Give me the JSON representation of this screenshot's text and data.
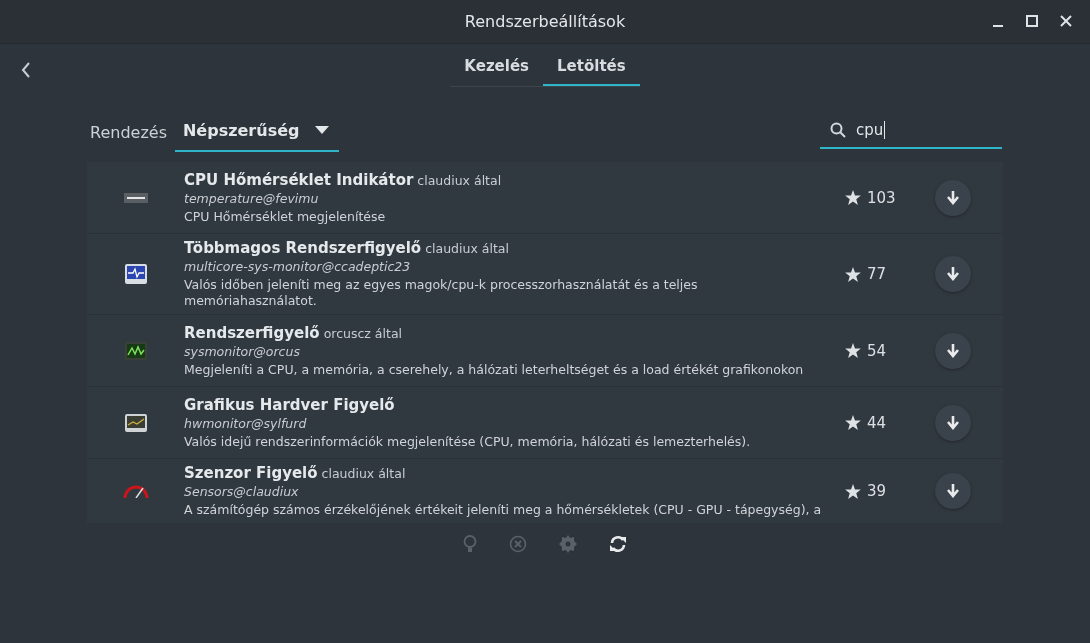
{
  "window": {
    "title": "Rendszerbeállítások"
  },
  "tabs": [
    {
      "label": "Kezelés",
      "selected": false
    },
    {
      "label": "Letöltés",
      "selected": true
    }
  ],
  "sort": {
    "label": "Rendezés",
    "value": "Népszerűség"
  },
  "search": {
    "value": "cpu"
  },
  "applets": [
    {
      "kind": "temp",
      "name": "CPU Hőmérséklet Indikátor",
      "author": "claudiux által",
      "uuid": "temperature@fevimu",
      "description": "CPU Hőmérséklet megjelenítése",
      "rating": "103"
    },
    {
      "kind": "pulse",
      "name": "Többmagos Rendszerfigyelő",
      "author": "claudiux által",
      "uuid": "multicore-sys-monitor@ccadeptic23",
      "description": "Valós időben jeleníti meg az egyes magok/cpu-k processzorhasználatát és a teljes memóriahasználatot.",
      "rating": "77"
    },
    {
      "kind": "graph",
      "name": "Rendszerfigyelő",
      "author": "orcuscz által",
      "uuid": "sysmonitor@orcus",
      "description": "Megjeleníti a CPU, a memória, a cserehely, a hálózati leterheltséget és a load értékét grafikonokon",
      "rating": "54"
    },
    {
      "kind": "screen",
      "name": "Grafikus Hardver Figyelő",
      "uuid": "hwmonitor@sylfurd",
      "description": "Valós idejű rendszerinformációk megjelenítése (CPU, memória, hálózati és lemezterhelés).",
      "rating": "44"
    },
    {
      "kind": "gauge",
      "name": "Szenzor Figyelő",
      "author": "claudiux által",
      "uuid": "Sensors@claudiux",
      "description": "A számítógép számos érzékelőjének értékeit jeleníti meg a hőmérsékletek (CPU - GPU - tápegység), a",
      "rating": "39"
    }
  ],
  "footer": [
    {
      "kind": "info",
      "disabled": true
    },
    {
      "kind": "remove",
      "disabled": true
    },
    {
      "kind": "settings",
      "disabled": true
    },
    {
      "kind": "refresh",
      "disabled": false
    }
  ]
}
